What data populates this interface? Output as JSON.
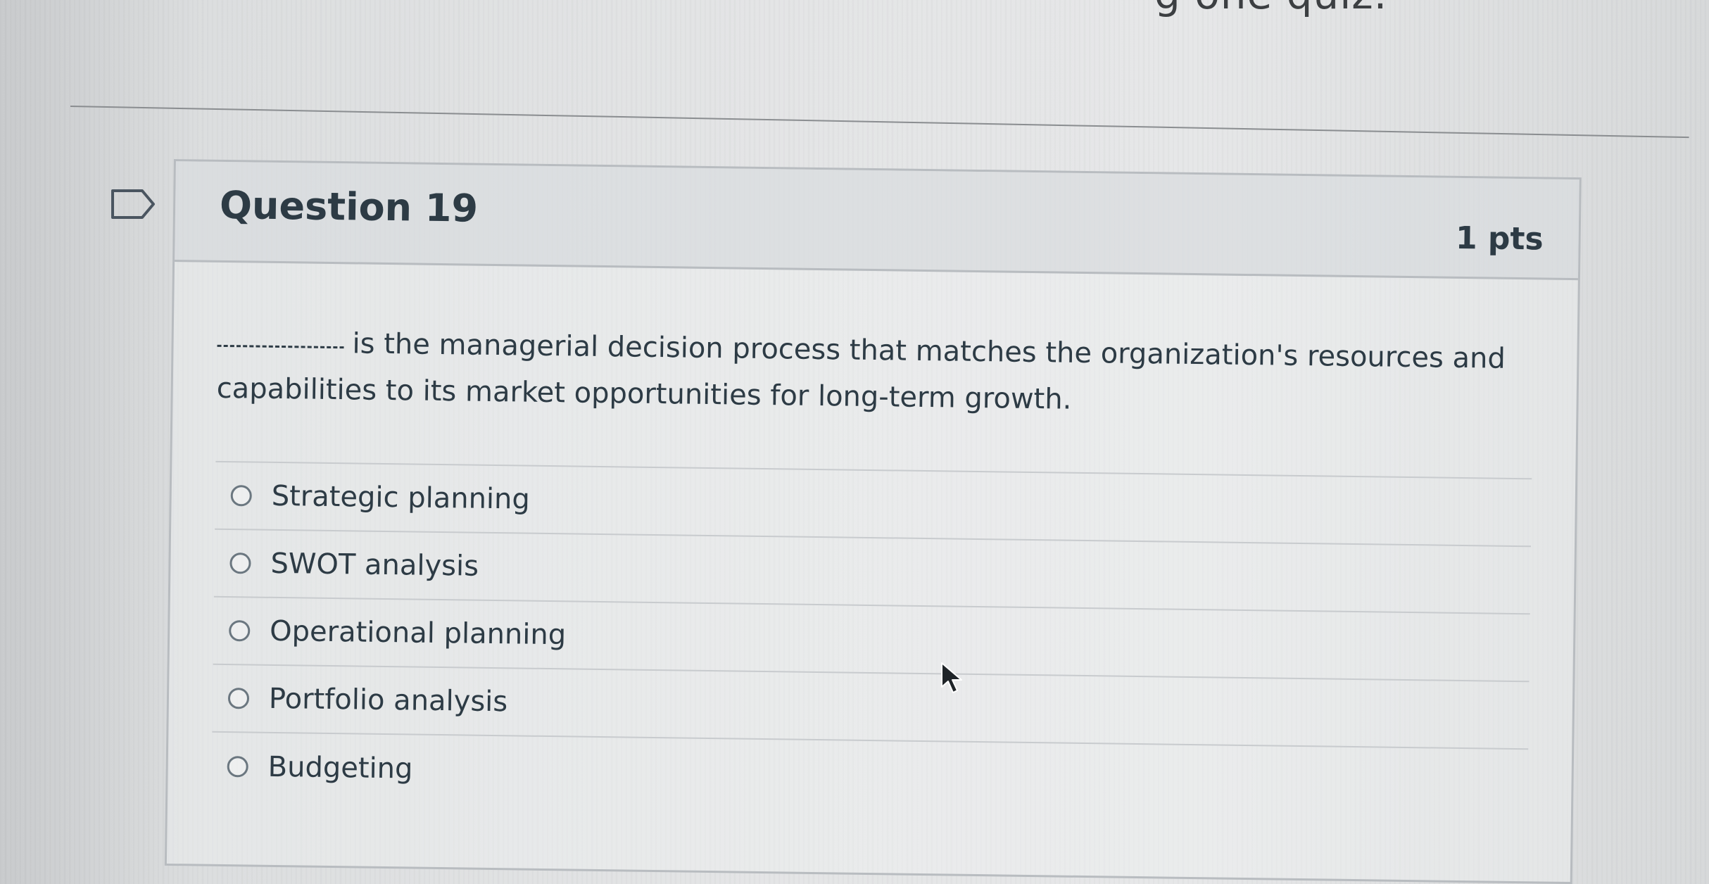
{
  "page": {
    "top_partial_text": "g one quiz."
  },
  "question": {
    "title": "Question 19",
    "points": "1 pts",
    "text": "is the managerial decision process that matches the organization's resources and capabilities to its market opportunities for long-term growth.",
    "answers": [
      {
        "label": "Strategic planning"
      },
      {
        "label": "SWOT analysis"
      },
      {
        "label": "Operational planning"
      },
      {
        "label": "Portfolio analysis"
      },
      {
        "label": "Budgeting"
      }
    ]
  },
  "icons": {
    "flag": "flag-icon",
    "radio": "radio-unselected-icon",
    "cursor": "mouse-cursor-icon"
  },
  "colors": {
    "text": "#2d3b45",
    "border": "#b8bcc0",
    "header_bg": "#d2d5d8"
  }
}
